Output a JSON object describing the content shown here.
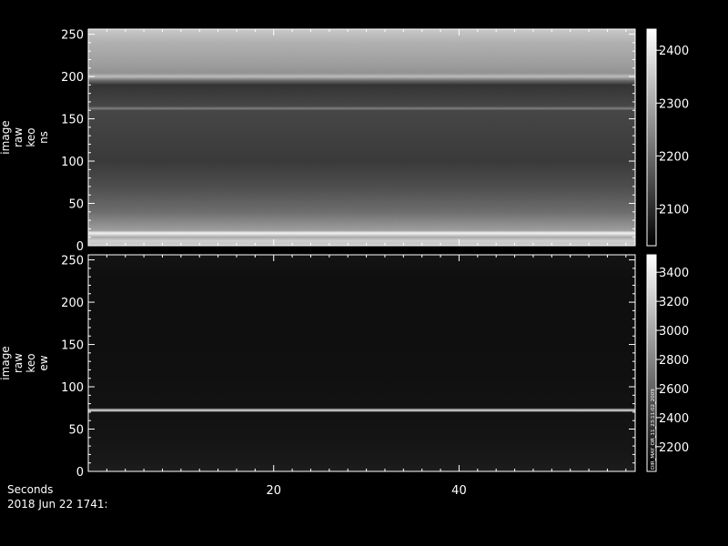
{
  "chart_data": [
    {
      "type": "heatmap",
      "ylabel": [
        "image",
        "raw",
        "keo",
        "ns"
      ],
      "yticks": [
        0,
        50,
        100,
        150,
        200,
        250
      ],
      "ylim": [
        0,
        256
      ],
      "colorbar_ticks": [
        2100,
        2200,
        2300,
        2400
      ],
      "colorbar_range": [
        2030,
        2440
      ],
      "row_profile": [
        {
          "y": 0,
          "v": 2340
        },
        {
          "y": 6,
          "v": 2360
        },
        {
          "y": 10,
          "v": 2300
        },
        {
          "y": 15,
          "v": 2420
        },
        {
          "y": 18,
          "v": 2280
        },
        {
          "y": 40,
          "v": 2200
        },
        {
          "y": 70,
          "v": 2150
        },
        {
          "y": 100,
          "v": 2120
        },
        {
          "y": 130,
          "v": 2130
        },
        {
          "y": 160,
          "v": 2140
        },
        {
          "y": 162,
          "v": 2230
        },
        {
          "y": 165,
          "v": 2140
        },
        {
          "y": 190,
          "v": 2110
        },
        {
          "y": 195,
          "v": 2190
        },
        {
          "y": 200,
          "v": 2330
        },
        {
          "y": 204,
          "v": 2260
        },
        {
          "y": 215,
          "v": 2280
        },
        {
          "y": 240,
          "v": 2310
        },
        {
          "y": 256,
          "v": 2350
        }
      ]
    },
    {
      "type": "heatmap",
      "ylabel": [
        "image",
        "raw",
        "keo",
        "ew"
      ],
      "yticks": [
        0,
        50,
        100,
        150,
        200,
        250
      ],
      "ylim": [
        0,
        256
      ],
      "colorbar_ticks": [
        2200,
        2400,
        2600,
        2800,
        3000,
        3200,
        3400
      ],
      "colorbar_range": [
        2030,
        3520
      ],
      "colorbar_note": "DIR_MAY_OR_11_23:11:02_2009",
      "row_profile": [
        {
          "y": 0,
          "v": 2200
        },
        {
          "y": 10,
          "v": 2170
        },
        {
          "y": 40,
          "v": 2140
        },
        {
          "y": 70,
          "v": 2130
        },
        {
          "y": 72,
          "v": 3400
        },
        {
          "y": 75,
          "v": 2130
        },
        {
          "y": 150,
          "v": 2110
        },
        {
          "y": 230,
          "v": 2110
        },
        {
          "y": 256,
          "v": 2140
        }
      ]
    }
  ],
  "x_axis": {
    "label": "Seconds",
    "ticks": [
      20,
      40
    ],
    "xlim": [
      0,
      59
    ]
  },
  "timestamp": "2018 Jun 22 1741:"
}
